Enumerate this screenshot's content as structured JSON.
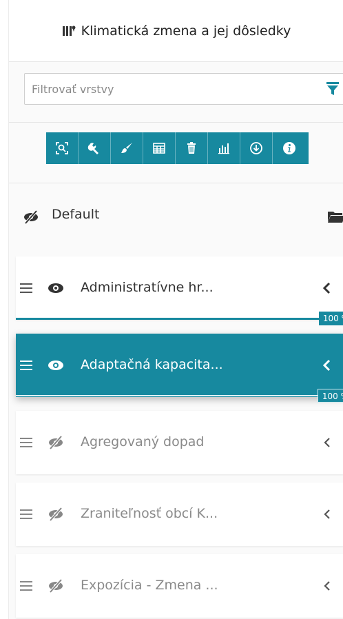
{
  "header": {
    "title": "Klimatická zmena a jej dôsledky",
    "icon": "map-icon"
  },
  "filter": {
    "placeholder": "Filtrovať vrstvy",
    "value": ""
  },
  "toolbar": {
    "color": "#17899f",
    "tools": [
      "zoom-to-extent-icon",
      "wrench-icon",
      "brush-icon",
      "table-icon",
      "trash-icon",
      "bar-chart-icon",
      "download-icon",
      "info-icon"
    ]
  },
  "group": {
    "label": "Default",
    "visible": false
  },
  "layers": [
    {
      "label": "Administratívne hr...",
      "visible": true,
      "active": false,
      "opacity": "100 %"
    },
    {
      "label": "Adaptačná kapacita...",
      "visible": true,
      "active": true,
      "opacity": "100 %"
    },
    {
      "label": "Agregovaný dopad",
      "visible": false,
      "active": false
    },
    {
      "label": "Zraniteľnosť obcí K...",
      "visible": false,
      "active": false
    },
    {
      "label": "Expozícia - Zmena ...",
      "visible": false,
      "active": false
    }
  ]
}
